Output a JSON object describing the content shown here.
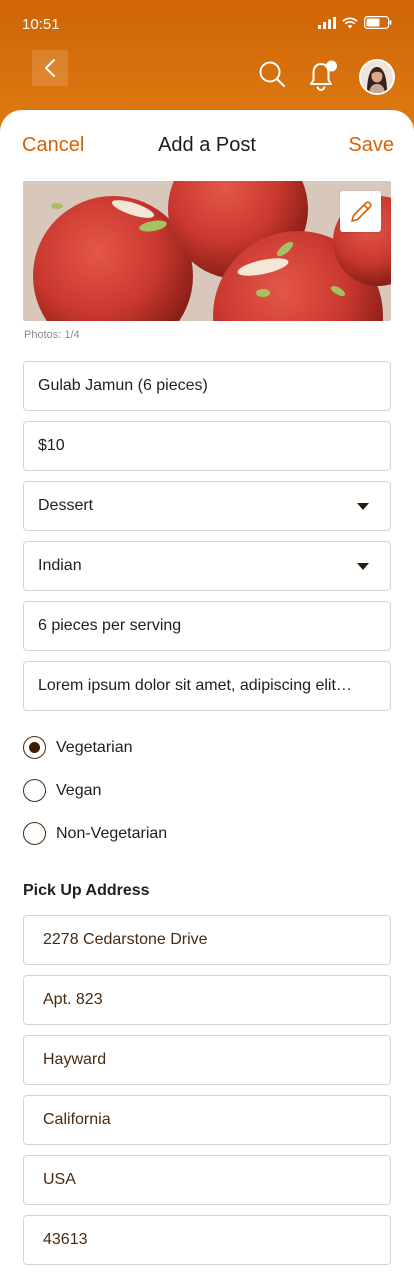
{
  "status": {
    "time": "10:51"
  },
  "header": {
    "icons": [
      "back-arrow-icon",
      "search-icon",
      "bell-icon",
      "avatar"
    ],
    "notification_dot": true
  },
  "form": {
    "cancel_label": "Cancel",
    "title": "Add a Post",
    "save_label": "Save",
    "photos_count": "Photos: 1/4",
    "dish_name": "Gulab Jamun (6 pieces)",
    "price": "$10",
    "category": "Dessert",
    "cuisine": "Indian",
    "serving": "6 pieces per serving",
    "description": "Lorem ipsum dolor sit amet, adipiscing elit…",
    "diet_options": [
      {
        "label": "Vegetarian",
        "selected": true
      },
      {
        "label": "Vegan",
        "selected": false
      },
      {
        "label": "Non-Vegetarian",
        "selected": false
      }
    ],
    "pickup_label": "Pick Up Address",
    "address": {
      "street": "2278 Cedarstone Drive",
      "unit": "Apt. 823",
      "city": "Hayward",
      "state": "California",
      "country": "USA",
      "zip": "43613"
    }
  },
  "colors": {
    "accent": "#d56306",
    "header": "#d9700c",
    "radio": "#3a1e0a"
  }
}
